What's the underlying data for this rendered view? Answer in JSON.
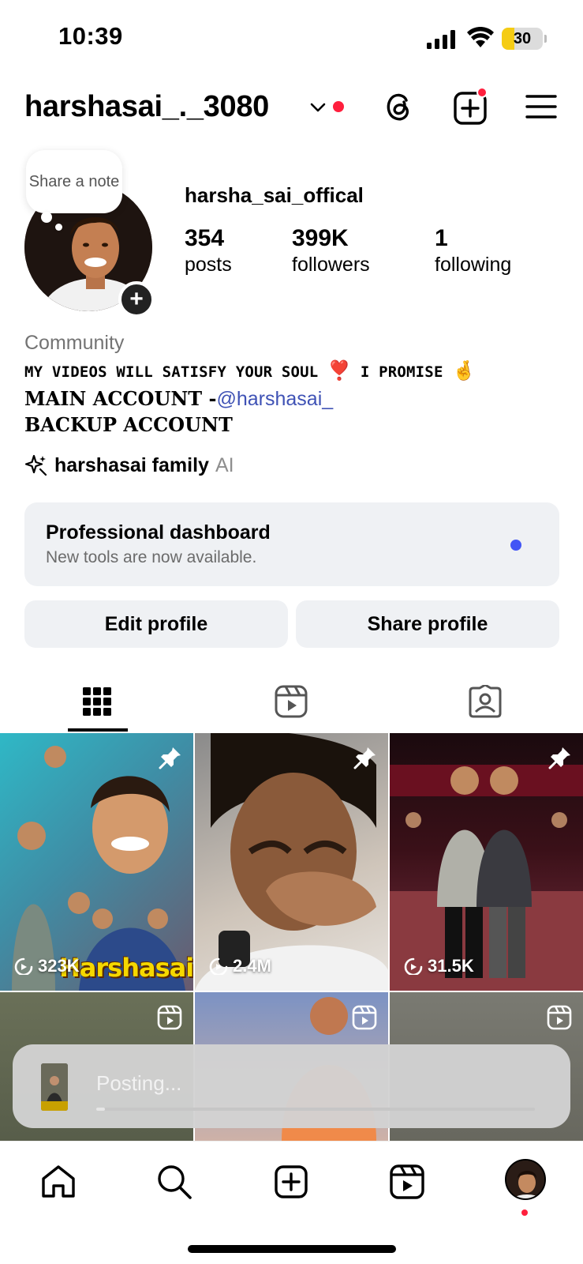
{
  "status_bar": {
    "time": "10:39",
    "battery": "30",
    "battery_level": 0.3
  },
  "header": {
    "username": "harshasai_._3080"
  },
  "profile": {
    "note_text": "Share a note",
    "display_name": "harsha_sai_offical",
    "stats": [
      {
        "value": "354",
        "label": "posts"
      },
      {
        "value": "399K",
        "label": "followers"
      },
      {
        "value": "1",
        "label": "following"
      }
    ],
    "category": "Community",
    "bio_line1": "MY VIDEOS WILL SATISFY YOUR SOUL",
    "bio_line1_emoji1": "❣️",
    "bio_line1_mid": "I PROMISE",
    "bio_line1_emoji2": "🤞",
    "bio_line2_prefix": "MAIN ACCOUNT -",
    "bio_line2_mention": "@harshasai_",
    "bio_line3": "BACKUP ACCOUNT",
    "ai_name": "harshasai family",
    "ai_tag": "AI"
  },
  "dashboard": {
    "title": "Professional dashboard",
    "subtitle": "New tools are now available."
  },
  "buttons": {
    "edit": "Edit profile",
    "share": "Share profile"
  },
  "tabs": [
    "grid-icon",
    "reels-icon",
    "tagged-icon"
  ],
  "grid": [
    {
      "views": "323K",
      "pinned": true,
      "title": "Harshasai"
    },
    {
      "views": "2.4M",
      "pinned": true
    },
    {
      "views": "31.5K",
      "pinned": true
    },
    {
      "reel": true
    },
    {
      "reel": true
    },
    {
      "reel": true
    }
  ],
  "posting": {
    "text": "Posting...",
    "progress": 0.02
  },
  "colors": {
    "accent_red": "#ff1f3d",
    "link_blue": "#3f52b5",
    "dot_blue": "#4255f5",
    "card_gray": "#eff1f4"
  },
  "nav": [
    "home-icon",
    "search-icon",
    "create-icon",
    "reels-icon",
    "profile-avatar"
  ]
}
